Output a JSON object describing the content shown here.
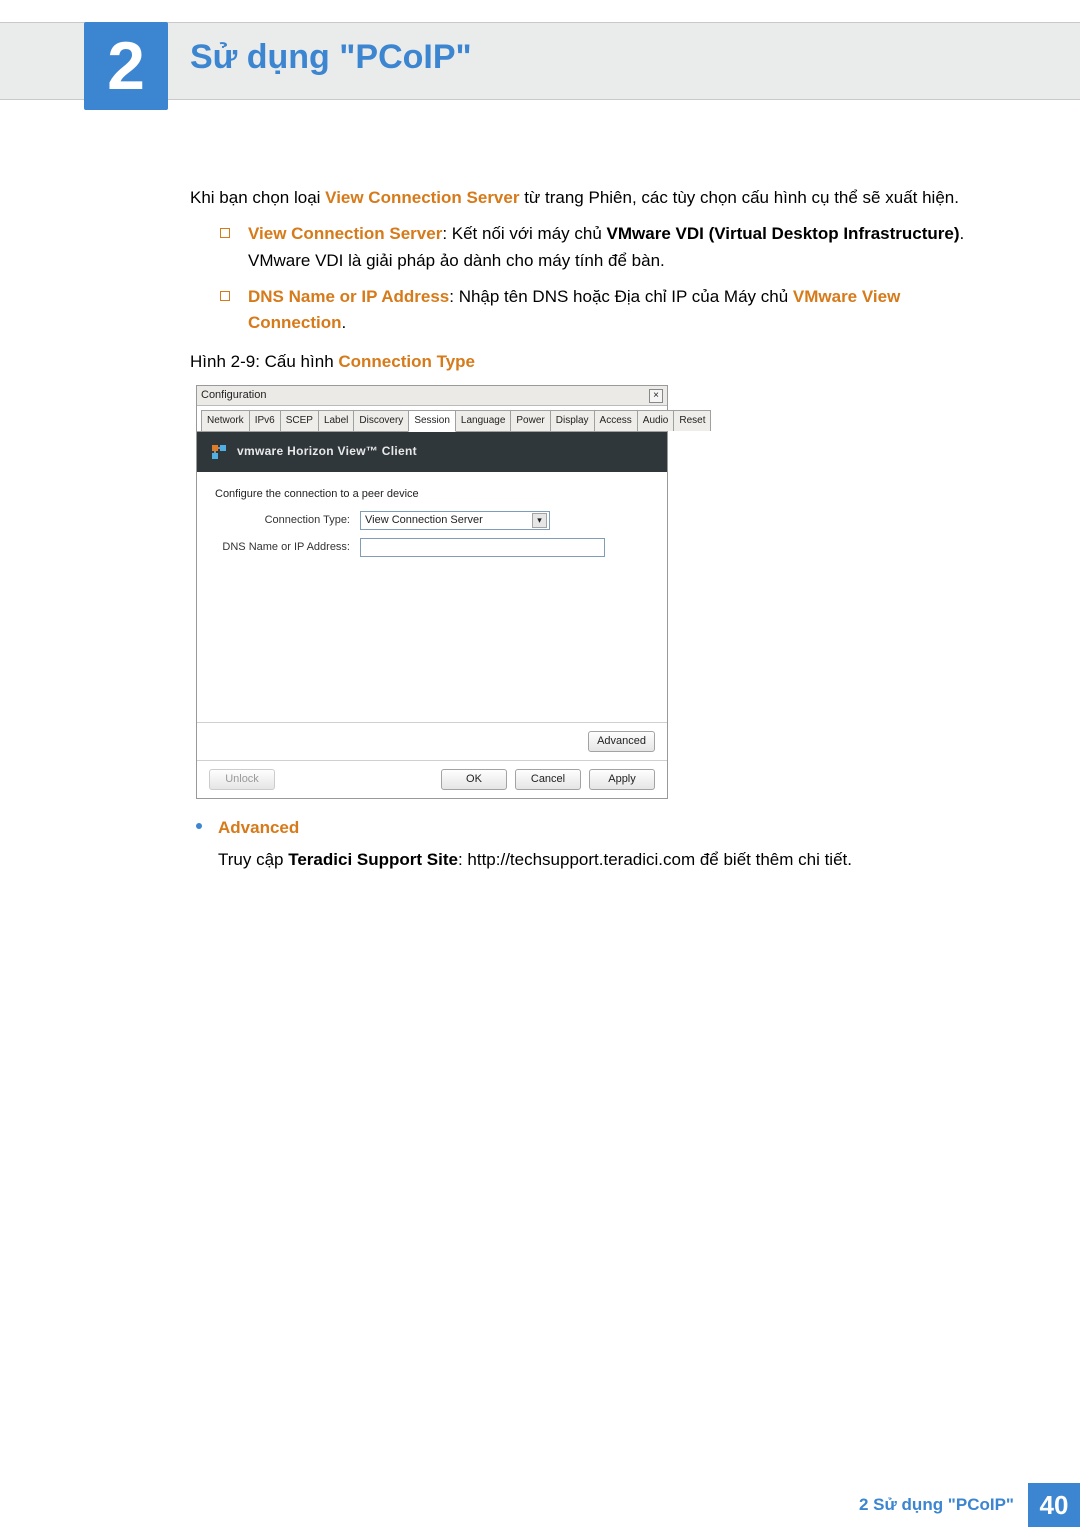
{
  "chapter": {
    "number": "2",
    "title": "Sử dụng \"PCoIP\""
  },
  "intro": {
    "prefix": "Khi bạn chọn loại ",
    "hl": "View Connection Server",
    "suffix": " từ trang Phiên, các tùy chọn cấu hình cụ thể sẽ xuất hiện."
  },
  "bullets": {
    "b1": {
      "hl": "View Connection Server",
      "text1": ": Kết nối với máy chủ ",
      "bold1": "VMware VDI (Virtual Desktop Infrastructure)",
      "text2": ". VMware VDI là giải pháp ảo dành cho máy tính để bàn."
    },
    "b2": {
      "hl1": "DNS Name or IP Address",
      "text1": ": Nhập tên DNS hoặc Địa chỉ IP của Máy chủ ",
      "hl2": "VMware View Connection",
      "text2": "."
    }
  },
  "figcaption": {
    "prefix": "Hình 2-9: Cấu hình ",
    "hl": "Connection Type"
  },
  "dialog": {
    "title": "Configuration",
    "tabs": [
      "Network",
      "IPv6",
      "SCEP",
      "Label",
      "Discovery",
      "Session",
      "Language",
      "Power",
      "Display",
      "Access",
      "Audio",
      "Reset"
    ],
    "activeTab": 5,
    "bannerText": "vmware Horizon View™ Client",
    "peerText": "Configure the connection to a peer device",
    "labelConnType": "Connection Type:",
    "labelDNS": "DNS Name or IP Address:",
    "connTypeValue": "View Connection Server",
    "btnAdvanced": "Advanced",
    "btnUnlock": "Unlock",
    "btnOK": "OK",
    "btnCancel": "Cancel",
    "btnApply": "Apply"
  },
  "advanced": {
    "hl": "Advanced",
    "text1": "Truy cập ",
    "bold": "Teradici Support Site",
    "text2": ": http://techsupport.teradici.com để biết thêm chi tiết."
  },
  "footer": {
    "text": "2 Sử dụng \"PCoIP\"",
    "page": "40"
  }
}
